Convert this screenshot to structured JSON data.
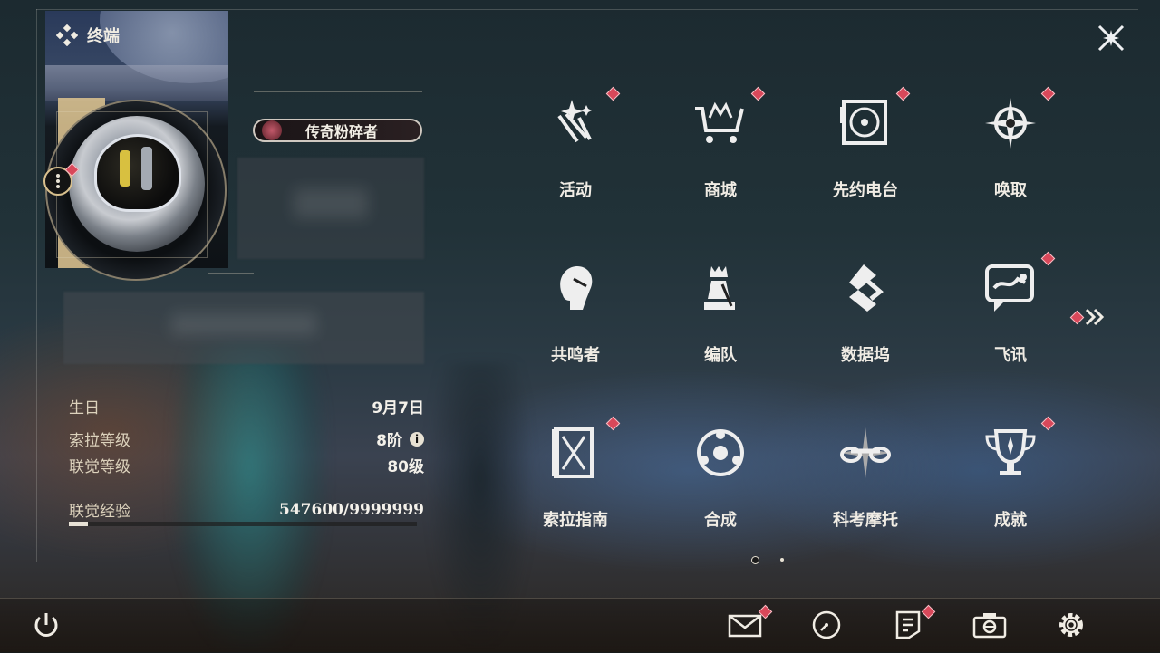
{
  "header": {
    "title": "终端"
  },
  "profile": {
    "title_badge": "传奇粉碎者"
  },
  "stats": {
    "birthday_label": "生日",
    "birthday_value": "9月7日",
    "sola_level_label": "索拉等级",
    "sola_level_value": "8阶",
    "union_level_label": "联觉等级",
    "union_level_value": "80级",
    "union_exp_label": "联觉经验",
    "union_exp_value": "547600/9999999",
    "union_exp_fraction": 0.055
  },
  "menu": [
    {
      "label": "活动",
      "icon": "sparkle-activity-icon",
      "badge": true
    },
    {
      "label": "商城",
      "icon": "shopping-cart-icon",
      "badge": true
    },
    {
      "label": "先约电台",
      "icon": "radio-record-icon",
      "badge": true
    },
    {
      "label": "唤取",
      "icon": "compass-star-icon",
      "badge": true
    },
    {
      "label": "共鸣者",
      "icon": "character-portrait-icon",
      "badge": false
    },
    {
      "label": "编队",
      "icon": "chess-team-icon",
      "badge": false
    },
    {
      "label": "数据坞",
      "icon": "data-dock-icon",
      "badge": false
    },
    {
      "label": "飞讯",
      "icon": "chat-message-icon",
      "badge": true
    },
    {
      "label": "索拉指南",
      "icon": "guide-book-icon",
      "badge": true
    },
    {
      "label": "合成",
      "icon": "synthesis-circle-icon",
      "badge": false
    },
    {
      "label": "科考摩托",
      "icon": "motorcycle-icon",
      "badge": false
    },
    {
      "label": "成就",
      "icon": "trophy-icon",
      "badge": true
    }
  ],
  "pagination": {
    "current": 1,
    "total": 2
  },
  "colors": {
    "accent_gold": "#d8c08e",
    "badge_red": "#d9485a",
    "text_light": "#f0ece4"
  },
  "bottom_bar": {
    "power": "power-icon",
    "mail": "mail-icon",
    "clock": "clock-icon",
    "notes": "notes-icon",
    "camera": "camera-icon",
    "settings": "settings-gear-icon"
  }
}
